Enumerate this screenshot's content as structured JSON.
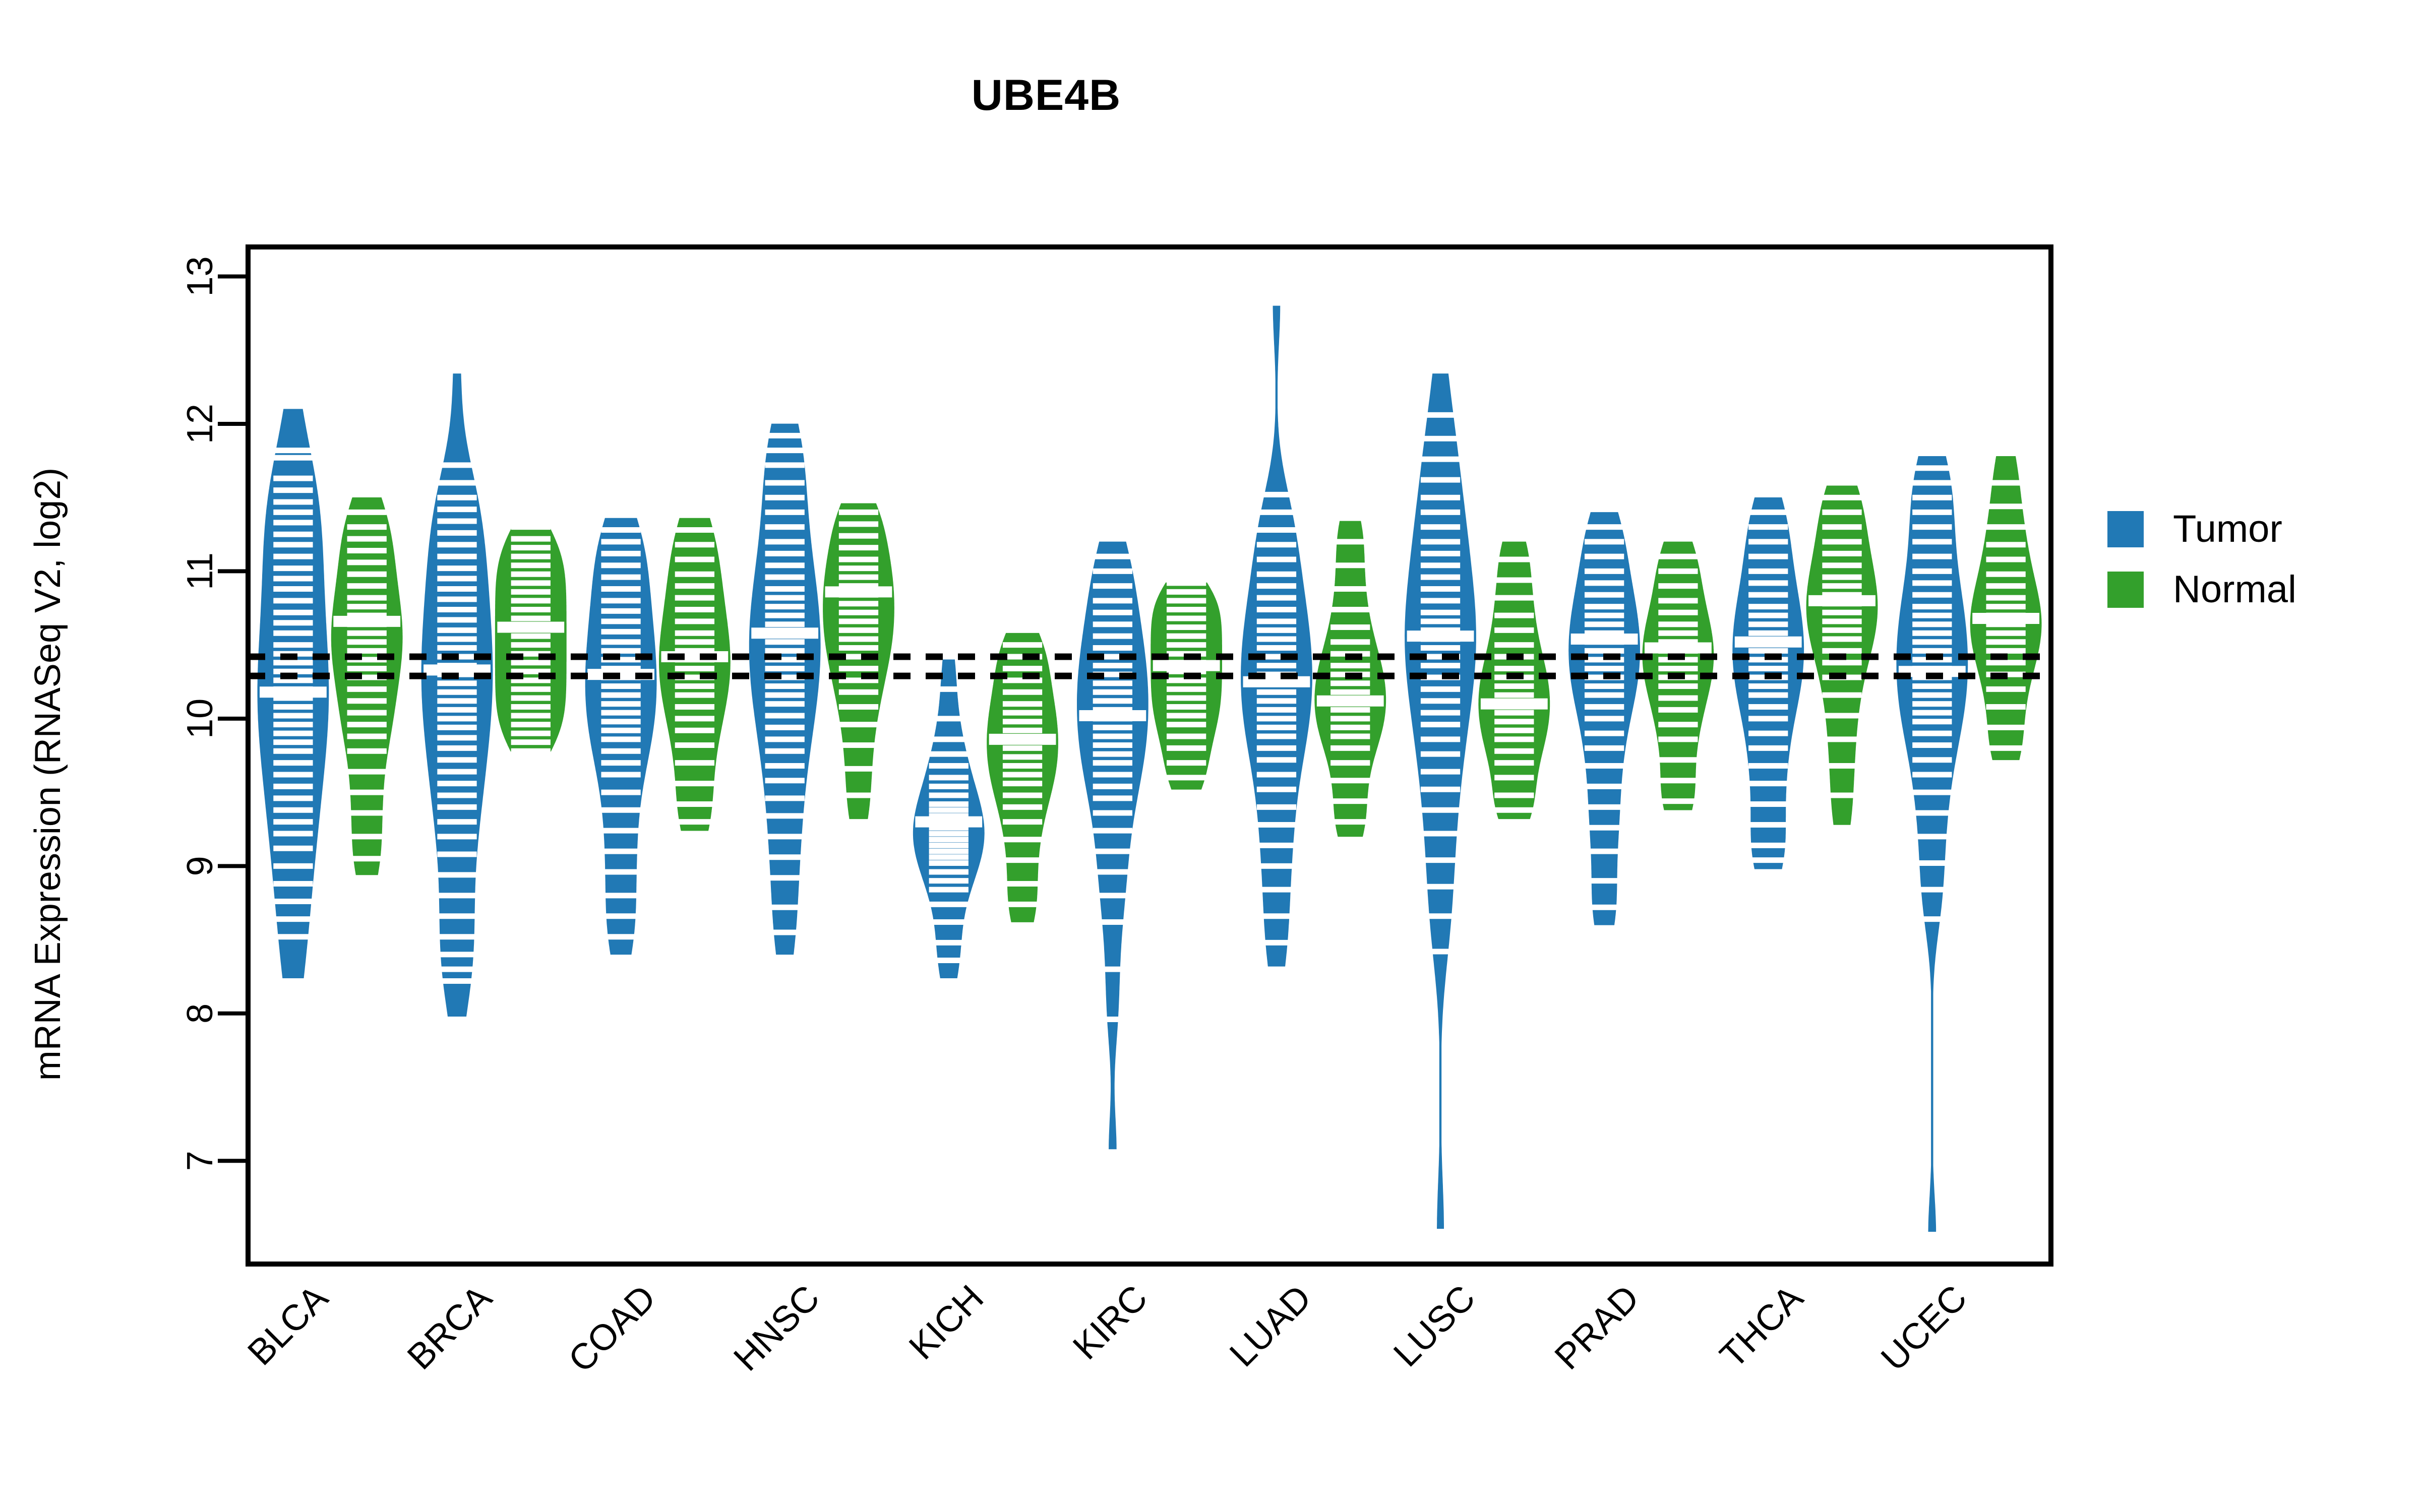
{
  "chart_data": {
    "type": "violin",
    "title": "UBE4B",
    "xlabel": "",
    "ylabel": "mRNA Expression (RNASeq V2, log2)",
    "ylim": [
      6.3,
      13.2
    ],
    "yticks": [
      7,
      8,
      9,
      10,
      11,
      12,
      13
    ],
    "ytick_labels": [
      "7",
      "8",
      "9",
      "10",
      "11",
      "12",
      "13"
    ],
    "grid": false,
    "legend_position": "right",
    "reference_lines": [
      10.42,
      10.29
    ],
    "categories": [
      "BLCA",
      "BRCA",
      "COAD",
      "HNSC",
      "KICH",
      "KIRC",
      "LUAD",
      "LUSC",
      "PRAD",
      "THCA",
      "UCEC"
    ],
    "series": [
      {
        "name": "Tumor",
        "color": "#2179B5"
      },
      {
        "name": "Normal",
        "color": "#33A02C"
      }
    ],
    "groups": [
      {
        "category": "BLCA",
        "tumor": {
          "median": 10.18,
          "q1": 9.72,
          "q3": 10.52,
          "min": 8.19,
          "max": 12.12,
          "mode": 10.15,
          "spread": 0.62,
          "points": [
            12.12,
            11.82,
            11.77,
            11.63,
            11.55,
            11.47,
            11.4,
            11.33,
            11.25,
            11.18,
            11.1,
            11.02,
            10.95,
            10.88,
            10.8,
            10.72,
            10.65,
            10.58,
            10.5,
            10.44,
            10.38,
            10.32,
            10.26,
            10.2,
            10.14,
            10.08,
            10.02,
            9.96,
            9.9,
            9.84,
            9.78,
            9.7,
            9.62,
            9.54,
            9.46,
            9.38,
            9.3,
            9.22,
            9.12,
            9.0,
            8.88,
            8.76,
            8.64,
            8.52,
            8.22,
            8.19
          ]
        },
        "normal": {
          "median": 10.66,
          "q1": 10.38,
          "q3": 10.92,
          "min": 8.92,
          "max": 11.52,
          "mode": 10.7,
          "spread": 0.38,
          "points": [
            11.52,
            11.4,
            11.3,
            11.22,
            11.14,
            11.06,
            10.98,
            10.9,
            10.82,
            10.76,
            10.7,
            10.64,
            10.58,
            10.52,
            10.46,
            10.4,
            10.34,
            10.28,
            10.2,
            10.12,
            10.04,
            9.96,
            9.88,
            9.78,
            9.64,
            9.5,
            9.36,
            9.2,
            9.05,
            8.92
          ]
        }
      },
      {
        "category": "BRCA",
        "tumor": {
          "median": 10.33,
          "q1": 9.92,
          "q3": 10.7,
          "min": 7.96,
          "max": 12.36,
          "mode": 10.35,
          "spread": 0.58,
          "points": [
            12.36,
            11.72,
            11.6,
            11.5,
            11.42,
            11.34,
            11.26,
            11.18,
            11.1,
            11.02,
            10.95,
            10.88,
            10.81,
            10.74,
            10.67,
            10.6,
            10.54,
            10.48,
            10.42,
            10.36,
            10.3,
            10.24,
            10.18,
            10.12,
            10.06,
            10.0,
            9.94,
            9.87,
            9.8,
            9.72,
            9.64,
            9.56,
            9.48,
            9.4,
            9.3,
            9.2,
            9.08,
            8.94,
            8.8,
            8.66,
            8.52,
            8.4,
            8.3,
            8.22,
            7.96
          ]
        },
        "normal": {
          "median": 10.62,
          "q1": 10.32,
          "q3": 10.88,
          "min": 9.78,
          "max": 11.3,
          "mode": 10.65,
          "spread": 0.35,
          "points": [
            11.3,
            11.22,
            11.16,
            11.1,
            11.04,
            10.98,
            10.92,
            10.86,
            10.8,
            10.74,
            10.68,
            10.62,
            10.56,
            10.5,
            10.44,
            10.38,
            10.32,
            10.26,
            10.2,
            10.14,
            10.08,
            10.02,
            9.96,
            9.9,
            9.84,
            9.78
          ]
        }
      },
      {
        "category": "COAD",
        "tumor": {
          "median": 10.3,
          "q1": 10.0,
          "q3": 10.6,
          "min": 8.38,
          "max": 11.38,
          "mode": 10.35,
          "spread": 0.45,
          "points": [
            11.38,
            11.28,
            11.2,
            11.12,
            11.04,
            10.96,
            10.88,
            10.8,
            10.73,
            10.66,
            10.59,
            10.52,
            10.46,
            10.4,
            10.34,
            10.28,
            10.22,
            10.16,
            10.1,
            10.04,
            9.98,
            9.92,
            9.86,
            9.78,
            9.7,
            9.62,
            9.5,
            9.38,
            9.24,
            9.1,
            8.96,
            8.8,
            8.66,
            8.52,
            8.38
          ]
        },
        "normal": {
          "median": 10.42,
          "q1": 10.12,
          "q3": 10.7,
          "min": 9.22,
          "max": 11.38,
          "mode": 10.44,
          "spread": 0.42,
          "points": [
            11.38,
            11.28,
            11.18,
            11.08,
            10.98,
            10.9,
            10.82,
            10.74,
            10.66,
            10.58,
            10.52,
            10.46,
            10.4,
            10.34,
            10.28,
            10.22,
            10.16,
            10.08,
            10.0,
            9.92,
            9.82,
            9.7,
            9.56,
            9.42,
            9.3,
            9.22
          ]
        }
      },
      {
        "category": "HNSC",
        "tumor": {
          "median": 10.58,
          "q1": 10.22,
          "q3": 10.92,
          "min": 8.38,
          "max": 12.02,
          "mode": 10.6,
          "spread": 0.52,
          "points": [
            12.02,
            11.92,
            11.82,
            11.72,
            11.6,
            11.5,
            11.4,
            11.3,
            11.2,
            11.12,
            11.04,
            10.96,
            10.88,
            10.82,
            10.76,
            10.7,
            10.64,
            10.58,
            10.52,
            10.46,
            10.4,
            10.34,
            10.28,
            10.22,
            10.16,
            10.1,
            10.02,
            9.94,
            9.86,
            9.78,
            9.68,
            9.58,
            9.46,
            9.34,
            9.2,
            9.06,
            8.92,
            8.72,
            8.55,
            8.38
          ]
        },
        "normal": {
          "median": 10.86,
          "q1": 10.58,
          "q3": 11.08,
          "min": 9.3,
          "max": 11.48,
          "mode": 10.88,
          "spread": 0.34,
          "points": [
            11.48,
            11.4,
            11.32,
            11.24,
            11.16,
            11.08,
            11.02,
            10.96,
            10.9,
            10.84,
            10.78,
            10.72,
            10.66,
            10.6,
            10.54,
            10.48,
            10.42,
            10.34,
            10.26,
            10.18,
            10.08,
            9.96,
            9.82,
            9.66,
            9.48,
            9.3
          ]
        }
      },
      {
        "category": "KICH",
        "tumor": {
          "median": 9.3,
          "q1": 9.04,
          "q3": 9.52,
          "min": 8.22,
          "max": 10.42,
          "mode": 9.28,
          "spread": 0.34,
          "points": [
            10.42,
            10.2,
            10.0,
            9.86,
            9.76,
            9.68,
            9.6,
            9.54,
            9.48,
            9.42,
            9.38,
            9.34,
            9.3,
            9.26,
            9.22,
            9.18,
            9.14,
            9.1,
            9.06,
            9.02,
            8.96,
            8.9,
            8.84,
            8.74,
            8.62,
            8.48,
            8.36,
            8.22
          ]
        },
        "normal": {
          "median": 9.86,
          "q1": 9.62,
          "q3": 10.1,
          "min": 8.6,
          "max": 10.6,
          "mode": 9.88,
          "spread": 0.32,
          "points": [
            10.6,
            10.5,
            10.42,
            10.34,
            10.26,
            10.18,
            10.1,
            10.04,
            9.98,
            9.92,
            9.86,
            9.8,
            9.74,
            9.68,
            9.62,
            9.56,
            9.48,
            9.4,
            9.3,
            9.18,
            9.04,
            8.88,
            8.74,
            8.6
          ]
        }
      },
      {
        "category": "KIRC",
        "tumor": {
          "median": 10.02,
          "q1": 9.7,
          "q3": 10.32,
          "min": 7.06,
          "max": 11.22,
          "mode": 10.0,
          "spread": 0.46,
          "points": [
            11.22,
            11.1,
            11.0,
            10.9,
            10.8,
            10.72,
            10.64,
            10.56,
            10.48,
            10.42,
            10.36,
            10.3,
            10.24,
            10.18,
            10.12,
            10.06,
            10.0,
            9.94,
            9.88,
            9.82,
            9.76,
            9.7,
            9.62,
            9.54,
            9.46,
            9.36,
            9.24,
            9.1,
            8.96,
            8.8,
            8.62,
            8.3,
            7.96,
            7.06
          ]
        },
        "normal": {
          "median": 10.36,
          "q1": 10.12,
          "q3": 10.6,
          "min": 9.5,
          "max": 10.92,
          "mode": 10.4,
          "spread": 0.28,
          "points": [
            10.92,
            10.86,
            10.8,
            10.74,
            10.68,
            10.62,
            10.56,
            10.5,
            10.44,
            10.38,
            10.32,
            10.26,
            10.2,
            10.14,
            10.08,
            10.02,
            9.96,
            9.88,
            9.8,
            9.7,
            9.6,
            9.5
          ]
        }
      },
      {
        "category": "LUAD",
        "tumor": {
          "median": 10.25,
          "q1": 9.9,
          "q3": 10.6,
          "min": 8.3,
          "max": 12.82,
          "mode": 10.26,
          "spread": 0.5,
          "points": [
            12.82,
            11.52,
            11.4,
            11.28,
            11.18,
            11.08,
            10.98,
            10.9,
            10.82,
            10.74,
            10.66,
            10.6,
            10.54,
            10.48,
            10.42,
            10.36,
            10.3,
            10.24,
            10.18,
            10.12,
            10.06,
            10.0,
            9.94,
            9.88,
            9.8,
            9.72,
            9.62,
            9.52,
            9.4,
            9.28,
            9.14,
            9.0,
            8.84,
            8.66,
            8.48,
            8.3
          ]
        },
        "normal": {
          "median": 10.12,
          "q1": 9.9,
          "q3": 10.36,
          "min": 9.18,
          "max": 11.36,
          "mode": 10.14,
          "spread": 0.3,
          "points": [
            11.36,
            11.2,
            11.04,
            10.88,
            10.74,
            10.62,
            10.52,
            10.44,
            10.36,
            10.3,
            10.24,
            10.18,
            10.12,
            10.06,
            10.0,
            9.94,
            9.88,
            9.8,
            9.7,
            9.58,
            9.44,
            9.3,
            9.18
          ]
        }
      },
      {
        "category": "LUSC",
        "tumor": {
          "median": 10.56,
          "q1": 10.12,
          "q3": 10.96,
          "min": 6.52,
          "max": 12.36,
          "mode": 10.6,
          "spread": 0.6,
          "points": [
            12.36,
            12.06,
            11.9,
            11.76,
            11.62,
            11.5,
            11.4,
            11.3,
            11.2,
            11.12,
            11.04,
            10.96,
            10.88,
            10.8,
            10.72,
            10.66,
            10.6,
            10.54,
            10.48,
            10.42,
            10.36,
            10.28,
            10.2,
            10.12,
            10.04,
            9.96,
            9.86,
            9.76,
            9.64,
            9.52,
            9.38,
            9.22,
            9.04,
            8.86,
            8.66,
            8.42,
            6.52
          ]
        },
        "normal": {
          "median": 10.1,
          "q1": 9.88,
          "q3": 10.34,
          "min": 9.3,
          "max": 11.22,
          "mode": 10.12,
          "spread": 0.3,
          "points": [
            11.22,
            11.08,
            10.94,
            10.82,
            10.7,
            10.6,
            10.5,
            10.42,
            10.34,
            10.28,
            10.22,
            10.16,
            10.1,
            10.04,
            9.98,
            9.92,
            9.86,
            9.78,
            9.7,
            9.6,
            9.48,
            9.38,
            9.3
          ]
        }
      },
      {
        "category": "PRAD",
        "tumor": {
          "median": 10.54,
          "q1": 10.26,
          "q3": 10.8,
          "min": 8.58,
          "max": 11.42,
          "mode": 10.56,
          "spread": 0.38,
          "points": [
            11.42,
            11.3,
            11.2,
            11.1,
            11.0,
            10.92,
            10.84,
            10.76,
            10.7,
            10.64,
            10.58,
            10.52,
            10.46,
            10.4,
            10.34,
            10.28,
            10.22,
            10.16,
            10.08,
            10.0,
            9.9,
            9.8,
            9.68,
            9.54,
            9.4,
            9.26,
            9.1,
            8.9,
            8.72,
            8.58
          ]
        },
        "normal": {
          "median": 10.48,
          "q1": 10.22,
          "q3": 10.72,
          "min": 9.36,
          "max": 11.22,
          "mode": 10.5,
          "spread": 0.32,
          "points": [
            11.22,
            11.1,
            11.0,
            10.9,
            10.8,
            10.72,
            10.64,
            10.58,
            10.52,
            10.46,
            10.4,
            10.34,
            10.28,
            10.22,
            10.14,
            10.06,
            9.96,
            9.86,
            9.72,
            9.58,
            9.44,
            9.36
          ]
        }
      },
      {
        "category": "THCA",
        "tumor": {
          "median": 10.52,
          "q1": 10.2,
          "q3": 10.8,
          "min": 8.96,
          "max": 11.52,
          "mode": 10.56,
          "spread": 0.4,
          "points": [
            11.52,
            11.4,
            11.3,
            11.2,
            11.1,
            11.0,
            10.92,
            10.84,
            10.76,
            10.7,
            10.64,
            10.58,
            10.52,
            10.46,
            10.4,
            10.34,
            10.28,
            10.22,
            10.16,
            10.08,
            10.0,
            9.9,
            9.8,
            9.68,
            9.56,
            9.42,
            9.28,
            9.14,
            9.04,
            8.96
          ]
        },
        "normal": {
          "median": 10.8,
          "q1": 10.52,
          "q3": 11.04,
          "min": 9.26,
          "max": 11.6,
          "mode": 10.82,
          "spread": 0.36,
          "points": [
            11.6,
            11.5,
            11.4,
            11.3,
            11.2,
            11.12,
            11.04,
            10.96,
            10.9,
            10.84,
            10.78,
            10.72,
            10.66,
            10.6,
            10.54,
            10.46,
            10.38,
            10.28,
            10.16,
            10.02,
            9.86,
            9.68,
            9.48,
            9.26
          ]
        }
      },
      {
        "category": "UCEC",
        "tumor": {
          "median": 10.32,
          "q1": 10.0,
          "q3": 10.66,
          "min": 6.5,
          "max": 11.8,
          "mode": 10.34,
          "spread": 0.46,
          "points": [
            11.8,
            11.7,
            11.6,
            11.5,
            11.4,
            11.3,
            11.2,
            11.1,
            11.0,
            10.92,
            10.84,
            10.76,
            10.7,
            10.64,
            10.58,
            10.52,
            10.46,
            10.4,
            10.34,
            10.28,
            10.22,
            10.16,
            10.1,
            10.04,
            9.98,
            9.9,
            9.82,
            9.72,
            9.62,
            9.5,
            9.36,
            9.2,
            9.02,
            8.84,
            8.64,
            6.5
          ]
        },
        "normal": {
          "median": 10.68,
          "q1": 10.4,
          "q3": 10.92,
          "min": 9.7,
          "max": 11.8,
          "mode": 10.7,
          "spread": 0.34,
          "points": [
            11.8,
            11.6,
            11.44,
            11.3,
            11.18,
            11.08,
            10.98,
            10.9,
            10.82,
            10.76,
            10.7,
            10.64,
            10.58,
            10.52,
            10.46,
            10.38,
            10.3,
            10.2,
            10.08,
            9.94,
            9.8,
            9.7
          ]
        }
      }
    ]
  },
  "legend": {
    "items": [
      {
        "label": "Tumor",
        "color": "#2179B5"
      },
      {
        "label": "Normal",
        "color": "#33A02C"
      }
    ]
  },
  "axis": {
    "frame_color": "#000000",
    "reference_line_color": "#000000"
  }
}
